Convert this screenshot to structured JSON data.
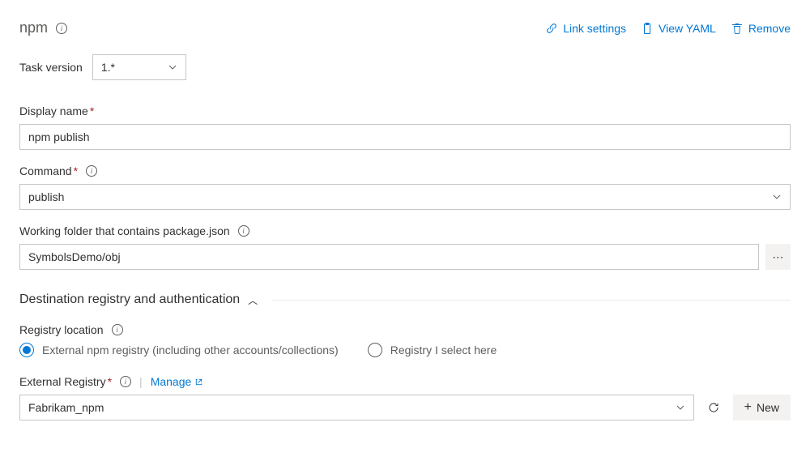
{
  "header": {
    "title": "npm",
    "actions": {
      "link_settings": "Link settings",
      "view_yaml": "View YAML",
      "remove": "Remove"
    }
  },
  "task_version": {
    "label": "Task version",
    "value": "1.*"
  },
  "display_name": {
    "label": "Display name",
    "value": "npm publish"
  },
  "command": {
    "label": "Command",
    "value": "publish"
  },
  "working_folder": {
    "label": "Working folder that contains package.json",
    "value": "SymbolsDemo/obj"
  },
  "section": {
    "title": "Destination registry and authentication"
  },
  "registry_location": {
    "label": "Registry location",
    "options": {
      "external": "External npm registry (including other accounts/collections)",
      "select_here": "Registry I select here"
    },
    "selected": "external"
  },
  "external_registry": {
    "label": "External Registry",
    "manage_label": "Manage",
    "value": "Fabrikam_npm",
    "new_label": "New"
  }
}
